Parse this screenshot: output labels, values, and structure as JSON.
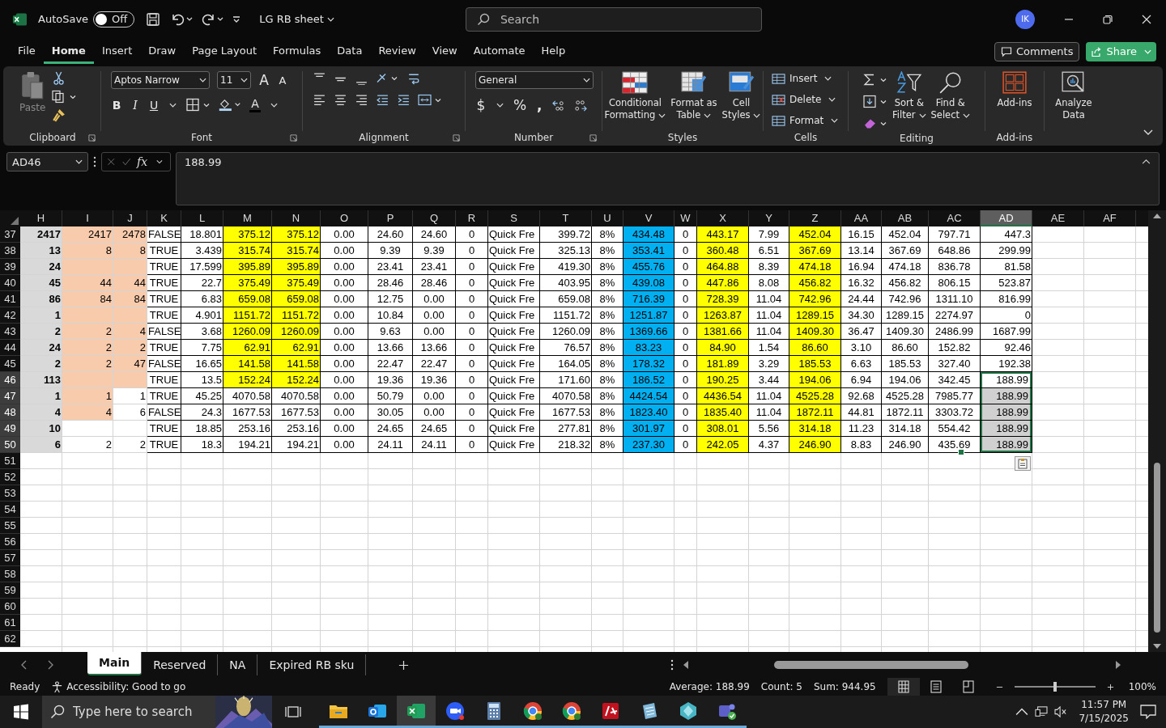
{
  "title_bar": {
    "autosave_label": "AutoSave",
    "autosave": {
      "on": false,
      "label": "Off"
    },
    "document_title": "LG RB sheet",
    "search_placeholder": "Search",
    "avatar": "IK"
  },
  "menu_tabs": [
    {
      "label": "File",
      "selected": false
    },
    {
      "label": "Home",
      "selected": true
    },
    {
      "label": "Insert",
      "selected": false
    },
    {
      "label": "Draw",
      "selected": false
    },
    {
      "label": "Page Layout",
      "selected": false
    },
    {
      "label": "Formulas",
      "selected": false
    },
    {
      "label": "Data",
      "selected": false
    },
    {
      "label": "Review",
      "selected": false
    },
    {
      "label": "View",
      "selected": false
    },
    {
      "label": "Automate",
      "selected": false
    },
    {
      "label": "Help",
      "selected": false
    }
  ],
  "comments_button": "Comments",
  "share_button": "Share",
  "ribbon": {
    "clipboard": {
      "label": "Clipboard",
      "paste": "Paste"
    },
    "font": {
      "label": "Font",
      "family": "Aptos Narrow",
      "size": "11",
      "grow": "A",
      "shrink": "A",
      "bold": "B",
      "italic": "I",
      "underline": "U",
      "color_letter": "A"
    },
    "alignment": {
      "label": "Alignment"
    },
    "number": {
      "label": "Number",
      "format": "General",
      "currency": "$",
      "percent": "%",
      "comma": ","
    },
    "styles": {
      "label": "Styles",
      "buttons": [
        {
          "lines": [
            "Conditional",
            "Formatting"
          ]
        },
        {
          "lines": [
            "Format as",
            "Table"
          ]
        },
        {
          "lines": [
            "Cell",
            "Styles"
          ]
        }
      ]
    },
    "cells": {
      "label": "Cells",
      "buttons": [
        "Insert",
        "Delete",
        "Format"
      ]
    },
    "editing": {
      "label": "Editing",
      "buttons": [
        {
          "lines": [
            "Sort &",
            "Filter"
          ]
        },
        {
          "lines": [
            "Find &",
            "Select"
          ]
        }
      ]
    },
    "addins": {
      "label": "Add-ins",
      "button": "Add-ins"
    },
    "analyze": {
      "lines": [
        "Analyze",
        "Data"
      ]
    }
  },
  "formula_bar": {
    "name_box": "AD46",
    "fx": "fx",
    "value": "188.99"
  },
  "columns": [
    {
      "name": "H",
      "selected": false,
      "color": "#d9d9d9"
    },
    {
      "name": "I",
      "selected": false
    },
    {
      "name": "J",
      "selected": false
    },
    {
      "name": "K",
      "selected": false
    },
    {
      "name": "L",
      "selected": false
    },
    {
      "name": "M",
      "selected": false
    },
    {
      "name": "N",
      "selected": false
    },
    {
      "name": "O",
      "selected": false
    },
    {
      "name": "P",
      "selected": false
    },
    {
      "name": "Q",
      "selected": false
    },
    {
      "name": "R",
      "selected": false
    },
    {
      "name": "S",
      "selected": false
    },
    {
      "name": "T",
      "selected": false
    },
    {
      "name": "U",
      "selected": false
    },
    {
      "name": "V",
      "selected": false,
      "color": "#00b0f0"
    },
    {
      "name": "W",
      "selected": false
    },
    {
      "name": "X",
      "selected": false,
      "color": "#ffff00"
    },
    {
      "name": "Y",
      "selected": false
    },
    {
      "name": "Z",
      "selected": false,
      "color": "#ffff00"
    },
    {
      "name": "AA",
      "selected": false
    },
    {
      "name": "AB",
      "selected": false
    },
    {
      "name": "AC",
      "selected": false
    },
    {
      "name": "AD",
      "selected": true
    },
    {
      "name": "AE",
      "selected": false
    },
    {
      "name": "AF",
      "selected": false
    }
  ],
  "rows": [
    {
      "number": "37",
      "selected": false,
      "cells": [
        "2417",
        {
          "text": "2417",
          "color": "#f8cbad"
        },
        {
          "text": "2478",
          "color": "#f8cbad"
        },
        "FALSE",
        "18.801",
        {
          "text": "375.12",
          "color": "#ffff00"
        },
        {
          "text": "375.12",
          "color": "#ffff00"
        },
        "0.00",
        "24.60",
        "24.60",
        "0",
        "Quick Fre",
        "399.72",
        "8%",
        "434.48",
        "0",
        "443.17",
        "7.99",
        "452.04",
        "16.15",
        "452.04",
        "797.71",
        "447.3",
        null,
        null
      ]
    },
    {
      "number": "38",
      "selected": false,
      "cells": [
        "13",
        {
          "text": "8",
          "color": "#f8cbad"
        },
        {
          "text": "8",
          "color": "#f8cbad"
        },
        "TRUE",
        "3.439",
        {
          "text": "315.74",
          "color": "#ffff00"
        },
        {
          "text": "315.74",
          "color": "#ffff00"
        },
        "0.00",
        "9.39",
        "9.39",
        "0",
        "Quick Fre",
        "325.13",
        "8%",
        "353.41",
        "0",
        "360.48",
        "6.51",
        "367.69",
        "13.14",
        "367.69",
        "648.86",
        "299.99",
        null,
        null
      ]
    },
    {
      "number": "39",
      "selected": false,
      "cells": [
        "24",
        {
          "color": "#f8cbad"
        },
        {
          "color": "#f8cbad"
        },
        "TRUE",
        "17.599",
        {
          "text": "395.89",
          "color": "#ffff00"
        },
        {
          "text": "395.89",
          "color": "#ffff00"
        },
        "0.00",
        "23.41",
        "23.41",
        "0",
        "Quick Fre",
        "419.30",
        "8%",
        "455.76",
        "0",
        "464.88",
        "8.39",
        "474.18",
        "16.94",
        "474.18",
        "836.78",
        "81.58",
        null,
        null
      ]
    },
    {
      "number": "40",
      "selected": false,
      "cells": [
        "45",
        {
          "text": "44",
          "color": "#f8cbad"
        },
        {
          "text": "44",
          "color": "#f8cbad"
        },
        "TRUE",
        "22.7",
        {
          "text": "375.49",
          "color": "#ffff00"
        },
        {
          "text": "375.49",
          "color": "#ffff00"
        },
        "0.00",
        "28.46",
        "28.46",
        "0",
        "Quick Fre",
        "403.95",
        "8%",
        "439.08",
        "0",
        "447.86",
        "8.08",
        "456.82",
        "16.32",
        "456.82",
        "806.15",
        "523.87",
        null,
        null
      ]
    },
    {
      "number": "41",
      "selected": false,
      "cells": [
        "86",
        {
          "text": "84",
          "color": "#f8cbad"
        },
        {
          "text": "84",
          "color": "#f8cbad"
        },
        "TRUE",
        "6.83",
        {
          "text": "659.08",
          "color": "#ffff00"
        },
        {
          "text": "659.08",
          "color": "#ffff00"
        },
        "0.00",
        "12.75",
        "0.00",
        "0",
        "Quick Fre",
        "659.08",
        "8%",
        "716.39",
        "0",
        "728.39",
        "11.04",
        "742.96",
        "24.44",
        "742.96",
        "1311.10",
        "816.99",
        null,
        null
      ]
    },
    {
      "number": "42",
      "selected": false,
      "cells": [
        "1",
        {
          "color": "#f8cbad"
        },
        {
          "color": "#f8cbad"
        },
        "TRUE",
        "4.901",
        {
          "text": "1151.72",
          "color": "#ffff00"
        },
        {
          "text": "1151.72",
          "color": "#ffff00"
        },
        "0.00",
        "10.84",
        "0.00",
        "0",
        "Quick Fre",
        "1151.72",
        "8%",
        "1251.87",
        "0",
        "1263.87",
        "11.04",
        "1289.15",
        "34.30",
        "1289.15",
        "2274.97",
        "0",
        null,
        null
      ]
    },
    {
      "number": "43",
      "selected": false,
      "cells": [
        "2",
        {
          "text": "2",
          "color": "#f8cbad"
        },
        {
          "text": "4",
          "color": "#f8cbad"
        },
        "FALSE",
        "3.68",
        {
          "text": "1260.09",
          "color": "#ffff00"
        },
        {
          "text": "1260.09",
          "color": "#ffff00"
        },
        "0.00",
        "9.63",
        "0.00",
        "0",
        "Quick Fre",
        "1260.09",
        "8%",
        "1369.66",
        "0",
        "1381.66",
        "11.04",
        "1409.30",
        "36.47",
        "1409.30",
        "2486.99",
        "1687.99",
        null,
        null
      ]
    },
    {
      "number": "44",
      "selected": false,
      "cells": [
        "24",
        {
          "text": "2",
          "color": "#f8cbad"
        },
        {
          "text": "2",
          "color": "#f8cbad"
        },
        "TRUE",
        "7.75",
        {
          "text": "62.91",
          "color": "#ffff00"
        },
        {
          "text": "62.91",
          "color": "#ffff00"
        },
        "0.00",
        "13.66",
        "13.66",
        "0",
        "Quick Fre",
        "76.57",
        "8%",
        "83.23",
        "0",
        "84.90",
        "1.54",
        "86.60",
        "3.10",
        "86.60",
        "152.82",
        "92.46",
        null,
        null
      ]
    },
    {
      "number": "45",
      "selected": false,
      "cells": [
        "2",
        {
          "text": "2",
          "color": "#f8cbad"
        },
        {
          "text": "47",
          "color": "#f8cbad"
        },
        "FALSE",
        "16.65",
        {
          "text": "141.58",
          "color": "#ffff00"
        },
        {
          "text": "141.58",
          "color": "#ffff00"
        },
        "0.00",
        "22.47",
        "22.47",
        "0",
        "Quick Fre",
        "164.05",
        "8%",
        "178.32",
        "0",
        "181.89",
        "3.29",
        "185.53",
        "6.63",
        "185.53",
        "327.40",
        "192.38",
        null,
        null
      ]
    },
    {
      "number": "46",
      "selected": true,
      "cells": [
        "113",
        {
          "color": "#f8cbad"
        },
        {
          "color": "#f8cbad"
        },
        "TRUE",
        "13.5",
        {
          "text": "152.24",
          "color": "#ffff00"
        },
        {
          "text": "152.24",
          "color": "#ffff00"
        },
        "0.00",
        "19.36",
        "19.36",
        "0",
        "Quick Fre",
        "171.60",
        "8%",
        "186.52",
        "0",
        "190.25",
        "3.44",
        "194.06",
        "6.94",
        "194.06",
        "342.45",
        "188.99",
        null,
        null
      ]
    },
    {
      "number": "47",
      "selected": true,
      "cells": [
        "1",
        {
          "text": "1",
          "color": "#f8cbad"
        },
        "1",
        "TRUE",
        "45.25",
        "4070.58",
        "4070.58",
        "0.00",
        "50.79",
        "0.00",
        "0",
        "Quick Fre",
        "4070.58",
        "8%",
        "4424.54",
        "0",
        "4436.54",
        "11.04",
        "4525.28",
        "92.68",
        "4525.28",
        "7985.77",
        "188.99",
        null,
        null
      ]
    },
    {
      "number": "48",
      "selected": true,
      "cells": [
        "4",
        {
          "text": "4",
          "color": "#f8cbad"
        },
        "6",
        "FALSE",
        "24.3",
        "1677.53",
        "1677.53",
        "0.00",
        "30.05",
        "0.00",
        "0",
        "Quick Fre",
        "1677.53",
        "8%",
        "1823.40",
        "0",
        "1835.40",
        "11.04",
        "1872.11",
        "44.81",
        "1872.11",
        "3303.72",
        "188.99",
        null,
        null
      ]
    },
    {
      "number": "49",
      "selected": true,
      "cells": [
        "10",
        null,
        null,
        "TRUE",
        "18.85",
        "253.16",
        "253.16",
        "0.00",
        "24.65",
        "24.65",
        "0",
        "Quick Fre",
        "277.81",
        "8%",
        "301.97",
        "0",
        "308.01",
        "5.56",
        "314.18",
        "11.23",
        "314.18",
        "554.42",
        "188.99",
        null,
        null
      ]
    },
    {
      "number": "50",
      "selected": true,
      "cells": [
        "6",
        "2",
        "2",
        "TRUE",
        "18.3",
        "194.21",
        "194.21",
        "0.00",
        "24.11",
        "24.11",
        "0",
        "Quick Fre",
        "218.32",
        "8%",
        "237.30",
        "0",
        "242.05",
        "4.37",
        "246.90",
        "8.83",
        "246.90",
        "435.69",
        "188.99",
        null,
        null
      ]
    },
    {
      "number": "51",
      "selected": false
    },
    {
      "number": "52",
      "selected": false
    },
    {
      "number": "53",
      "selected": false
    },
    {
      "number": "54",
      "selected": false
    },
    {
      "number": "55",
      "selected": false
    },
    {
      "number": "56",
      "selected": false
    },
    {
      "number": "57",
      "selected": false
    },
    {
      "number": "58",
      "selected": false
    },
    {
      "number": "59",
      "selected": false
    },
    {
      "number": "60",
      "selected": false
    },
    {
      "number": "61",
      "selected": false
    },
    {
      "number": "62",
      "selected": false
    }
  ],
  "sheet_tabs": [
    {
      "label": "Main",
      "selected": true
    },
    {
      "label": "Reserved",
      "selected": false
    },
    {
      "label": "NA",
      "selected": false
    },
    {
      "label": "Expired RB sku",
      "selected": false
    }
  ],
  "status_bar": {
    "ready": "Ready",
    "accessibility": "Accessibility: Good to go",
    "average": "Average: 188.99",
    "count": "Count: 5",
    "sum": "Sum: 944.95",
    "zoom": {
      "level": 0.5,
      "label": "100%"
    }
  },
  "taskbar": {
    "search_placeholder": "Type here to search",
    "apps": [
      {
        "kind": "folder",
        "selected": false
      },
      {
        "kind": "mail",
        "selected": false
      },
      {
        "kind": "sheet",
        "selected": true
      },
      {
        "kind": "meeting",
        "selected": false
      },
      {
        "kind": "calculator",
        "selected": false
      },
      {
        "kind": "browser",
        "selected": false
      },
      {
        "kind": "browser",
        "selected": false
      },
      {
        "kind": "transfer",
        "selected": false
      },
      {
        "kind": "notepad",
        "selected": false
      },
      {
        "kind": "gem",
        "selected": false
      },
      {
        "kind": "chat",
        "selected": false
      }
    ],
    "time": "11:57 PM",
    "date": "7/15/2025"
  }
}
